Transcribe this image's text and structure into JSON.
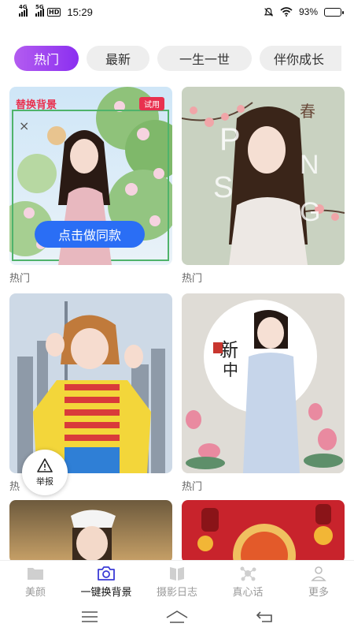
{
  "status_bar": {
    "network1": "4G",
    "network2": "5G",
    "hd": "HD",
    "time": "15:29",
    "battery": "93%",
    "battery_level": 0.93
  },
  "tabs": [
    {
      "label": "热门",
      "active": true
    },
    {
      "label": "最新",
      "active": false
    },
    {
      "label": "一生一世",
      "active": false
    },
    {
      "label": "伴你成长",
      "active": false
    }
  ],
  "cards": [
    {
      "caption": "热门",
      "badge_left": "替换背景",
      "badge_right": "试用",
      "cta": "点击做同款",
      "close": "×"
    },
    {
      "caption": "热门",
      "overlay_text": "N S P I R G",
      "stamp": "春"
    },
    {
      "caption": "热",
      "bg": "city"
    },
    {
      "caption": "热门",
      "overlay_text": "新中",
      "bg": "lotus"
    },
    {
      "caption": "",
      "bg": "sunset"
    },
    {
      "caption": "",
      "bg": "red-festival"
    }
  ],
  "report": {
    "label": "举报"
  },
  "bottom_nav": [
    {
      "label": "美颜",
      "icon": "folder-icon",
      "active": false
    },
    {
      "label": "一键换背景",
      "icon": "camera-icon",
      "active": true
    },
    {
      "label": "摄影日志",
      "icon": "book-icon",
      "active": false
    },
    {
      "label": "真心话",
      "icon": "molecule-icon",
      "active": false
    },
    {
      "label": "更多",
      "icon": "person-icon",
      "active": false
    }
  ],
  "colors": {
    "accent_purple": "#9b3ef0",
    "cta_blue": "#2a6ef5",
    "badge_red": "#e8314f"
  }
}
